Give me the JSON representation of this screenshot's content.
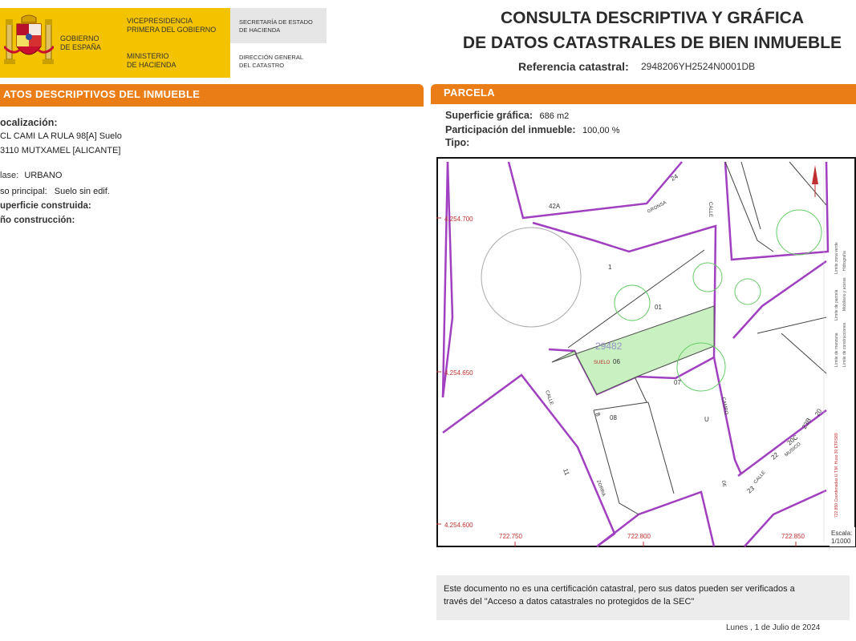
{
  "header": {
    "gov_line1": "GOBIERNO",
    "gov_line2": "DE ESPAÑA",
    "vp_line1": "VICEPRESIDENCIA",
    "vp_line2": "PRIMERA DEL GOBIERNO",
    "min_line1": "MINISTERIO",
    "min_line2": "DE HACIENDA",
    "sec_line1": "SECRETARÍA DE ESTADO",
    "sec_line2": "DE HACIENDA",
    "dir_line1": "DIRECCIÓN GENERAL",
    "dir_line2": "DEL CATASTRO",
    "title_line1": "CONSULTA DESCRIPTIVA Y GRÁFICA",
    "title_line2": "DE DATOS CATASTRALES DE BIEN INMUEBLE",
    "ref_label": "Referencia catastral:",
    "ref_value": "2948206YH2524N0001DB"
  },
  "left": {
    "section_title": "ATOS DESCRIPTIVOS DEL INMUEBLE",
    "loc_label": "ocalización:",
    "addr1": "CL CAMI LA RULA 98[A] Suelo",
    "addr2": "3110 MUTXAMEL [ALICANTE]",
    "clase_label": "lase:",
    "clase_value": "URBANO",
    "uso_label": "so principal:",
    "uso_value": "Suelo sin edif.",
    "sup_label": "uperficie construida:",
    "anio_label": "ño construcción:"
  },
  "right": {
    "section_title": "PARCELA",
    "sup_label": "Superficie gráfica:",
    "sup_value": "686 m2",
    "part_label": "Participación del inmueble:",
    "part_value": "100,00 %",
    "tipo_label": "Tipo:"
  },
  "map": {
    "coord_y_top": "4.254.700",
    "coord_y_mid": "4.254.650",
    "coord_y_bot": "4.254.600",
    "coord_x_left": "722.750",
    "coord_x_mid": "722.800",
    "coord_x_right": "722.850",
    "escala_label": "Escala:",
    "escala_value": "1/1000",
    "parcel_ref": "29482",
    "suelo_tag": "SUELO",
    "lot_01": "01",
    "lot_06": "06",
    "lot_07": "07",
    "lot_08": "08",
    "num_42a": "42A",
    "num_24": "24",
    "num_1": "1",
    "num_11": "11",
    "num_8": "8",
    "num_22": "22",
    "num_20c": "20C",
    "num_23": "23",
    "num_20": "20",
    "num_23b": "23B",
    "street_gronsa": "GRONSA",
    "street_calle1": "CALLE",
    "street_calle2": "CALLE",
    "street_calle3": "CALLE",
    "street_campo": "CAMPO",
    "street_zorra": "ZORRA",
    "street_de": "DE",
    "street_musico": "MUSICO",
    "street_u": "U",
    "legend_1": "Límite de manzana",
    "legend_2": "Límite de parcela",
    "legend_3": "Límite de construcciones",
    "legend_4": "Mobiliario y aceras",
    "legend_5": "Límite zona verde",
    "legend_6": "Hidrografía",
    "sidebar_text": "722.850 Coordenadas U.T.M. Huso 30 ETRS89"
  },
  "footer": {
    "note_line1": "Este documento no es una certificación catastral, pero sus datos pueden ser verificados a",
    "note_line2": "través del \"Acceso a datos catastrales no protegidos de la SEC\"",
    "date": "Lunes , 1 de Julio de 2024"
  },
  "colors": {
    "orange": "#ea7d16",
    "yellow": "#f4c300",
    "parcel_fill": "#c8f0c0",
    "block_line": "#a040c0"
  }
}
